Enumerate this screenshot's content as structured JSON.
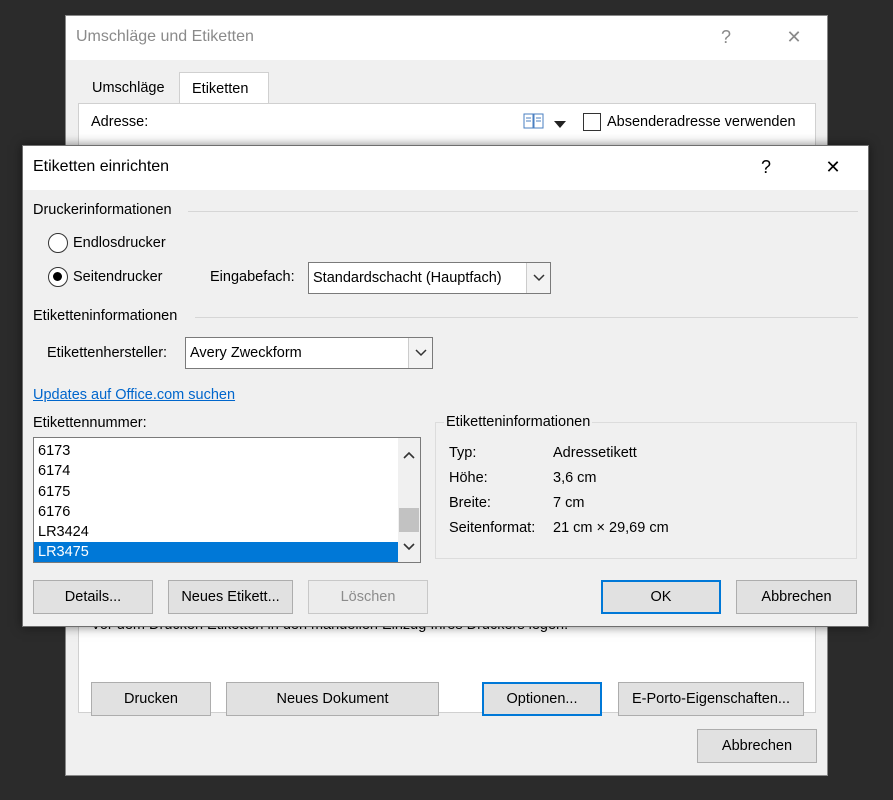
{
  "back_window": {
    "title": "Umschläge und Etiketten",
    "help_glyph": "?",
    "close_glyph": "✕",
    "tabs": [
      {
        "label": "Umschläge",
        "selected": false
      },
      {
        "label": "Etiketten",
        "selected": true
      }
    ],
    "address_label": "Adresse:",
    "sender_checkbox_label": "Absenderadresse verwenden",
    "sender_checked": false,
    "note": "Vor dem Drucken Etiketten in den manuellen Einzug Ihres Druckers legen.",
    "buttons": {
      "print": "Drucken",
      "new_document": "Neues Dokument",
      "options": "Optionen...",
      "eporto": "E-Porto-Eigenschaften...",
      "cancel": "Abbrechen"
    }
  },
  "dialog": {
    "title": "Etiketten einrichten",
    "help_glyph": "?",
    "close_glyph": "✕",
    "printer_group": "Druckerinformationen",
    "radio_continuous": "Endlosdrucker",
    "radio_page": "Seitendrucker",
    "selected_printer_type": "Seitendrucker",
    "tray_label": "Eingabefach:",
    "tray_value": "Standardschacht (Hauptfach)",
    "label_group": "Etiketteninformationen",
    "vendor_label": "Etikettenhersteller:",
    "vendor_value": "Avery Zweckform",
    "update_link": "Updates auf Office.com suchen",
    "number_label": "Etikettennummer:",
    "numbers": [
      "6173",
      "6174",
      "6175",
      "6176",
      "LR3424",
      "LR3475"
    ],
    "selected_number": "LR3475",
    "info_group": "Etiketteninformationen",
    "info": [
      {
        "key": "Typ:",
        "value": "Adressetikett"
      },
      {
        "key": "Höhe:",
        "value": "3,6 cm"
      },
      {
        "key": "Breite:",
        "value": "7 cm"
      },
      {
        "key": "Seitenformat:",
        "value": "21 cm × 29,69 cm"
      }
    ],
    "buttons": {
      "details": "Details...",
      "new_label": "Neues Etikett...",
      "delete": "Löschen",
      "ok": "OK",
      "cancel": "Abbrechen"
    }
  }
}
